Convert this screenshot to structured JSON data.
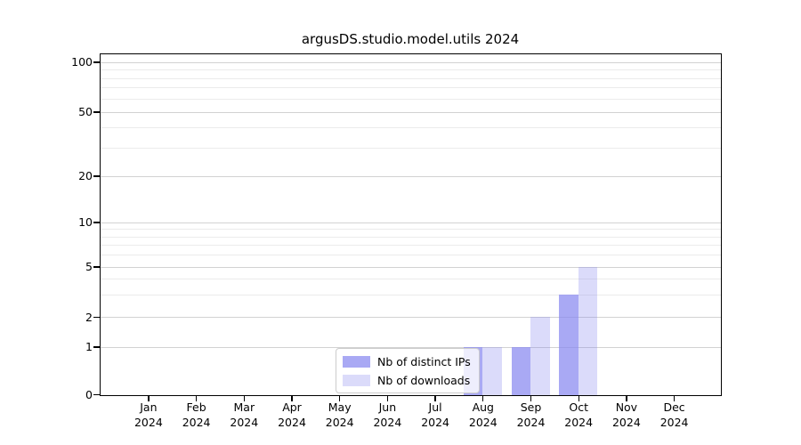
{
  "chart_data": {
    "type": "bar",
    "title": "argusDS.studio.model.utils 2024",
    "categories": [
      "Jan 2024",
      "Feb 2024",
      "Mar 2024",
      "Apr 2024",
      "May 2024",
      "Jun 2024",
      "Jul 2024",
      "Aug 2024",
      "Sep 2024",
      "Oct 2024",
      "Nov 2024",
      "Dec 2024"
    ],
    "series": [
      {
        "name": "Nb of distinct IPs",
        "values": [
          0,
          0,
          0,
          0,
          0,
          0,
          0,
          1,
          1,
          3,
          0,
          0
        ],
        "color": "#8888f0",
        "opacity": 0.72
      },
      {
        "name": "Nb of downloads",
        "values": [
          0,
          0,
          0,
          0,
          0,
          0,
          0,
          1,
          2,
          5,
          0,
          0
        ],
        "color": "#8888f0",
        "opacity": 0.3
      }
    ],
    "xlabel": "",
    "ylabel": "",
    "y_axis": {
      "scale": "symlog",
      "major_ticks": [
        0,
        1,
        2,
        5,
        10,
        20,
        50,
        100
      ],
      "minor_ticks": [
        3,
        4,
        6,
        7,
        8,
        9,
        30,
        40,
        60,
        70,
        80,
        90
      ],
      "ylim": [
        0,
        112
      ]
    },
    "grid": "on",
    "legend_position": "lower center",
    "colors": {
      "grid_major": "#d2d2d2",
      "grid_minor": "#ebebeb",
      "spine": "#000000",
      "background": "#ffffff"
    }
  }
}
